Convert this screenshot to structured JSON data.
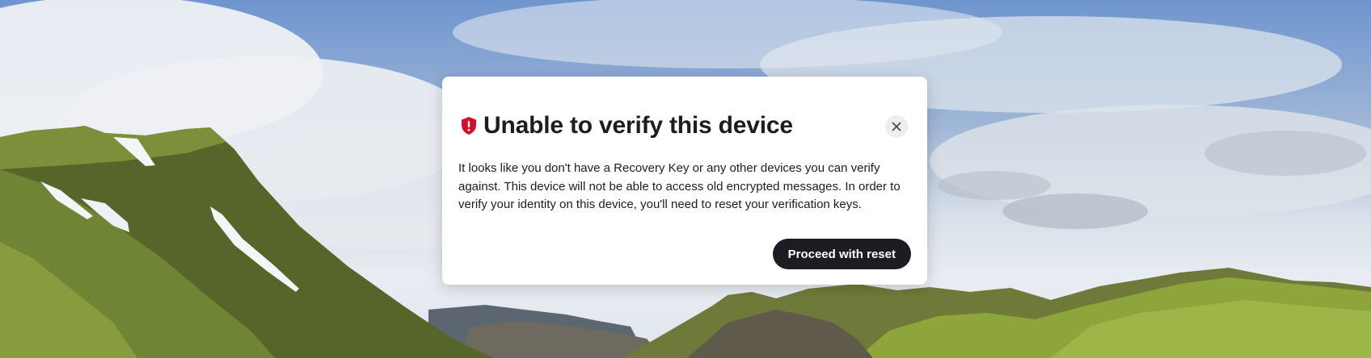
{
  "dialog": {
    "title": "Unable to verify this device",
    "title_icon": "shield-alert-icon",
    "close_icon": "close-icon",
    "body": "It looks like you don't have a Recovery Key or any other devices you can verify against. This device will not be able to access old encrypted messages. In order to verify your identity on this device, you'll need to reset your verification keys.",
    "primary_button_label": "Proceed with reset"
  },
  "colors": {
    "shield": "#d1102b",
    "button_bg": "#1b1d22",
    "text": "#1b1d22"
  }
}
